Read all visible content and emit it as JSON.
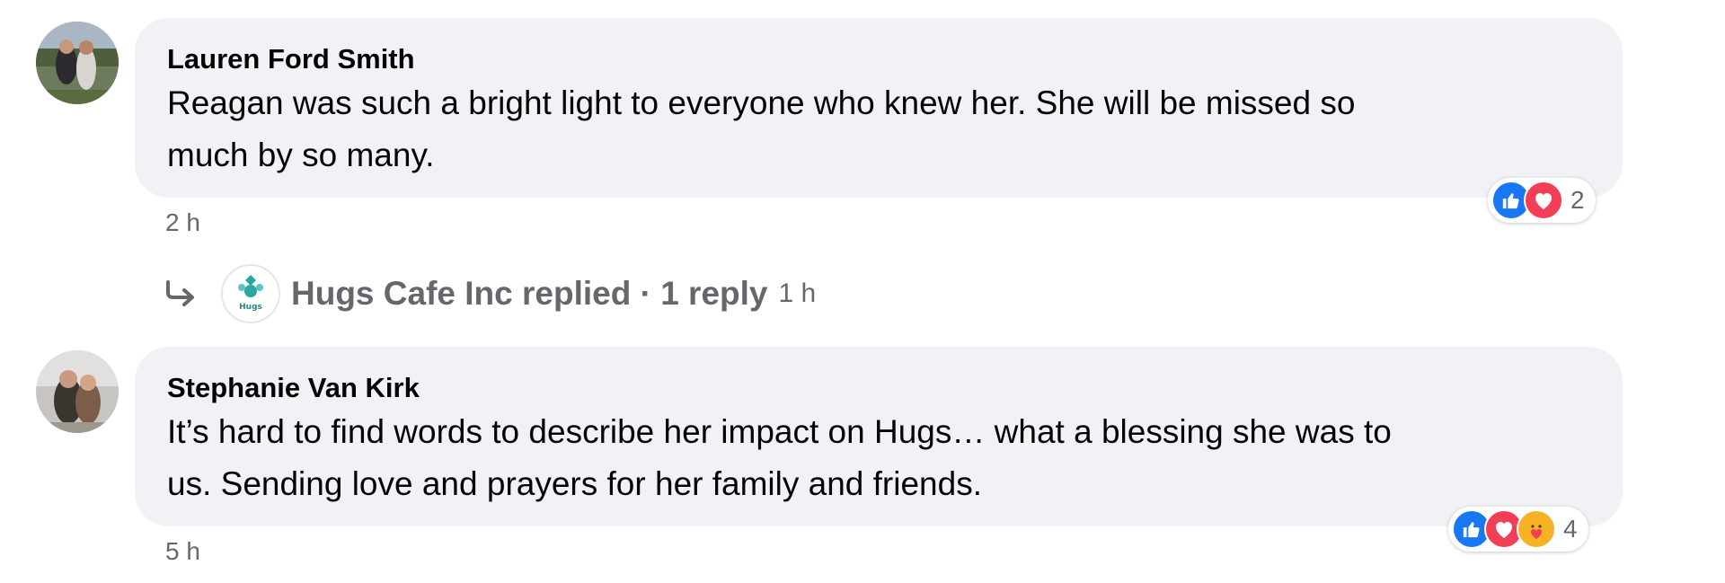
{
  "comments": [
    {
      "author": "Lauren Ford Smith",
      "text_line1": "Reagan was such a bright light to everyone who knew her. She will be missed so",
      "text_line2": "much by so many.",
      "time": "2 h",
      "reactions": [
        "like-icon",
        "love-icon"
      ],
      "reaction_count": "2"
    },
    {
      "author": "Stephanie Van Kirk",
      "text_line1": "It’s hard to find words to describe her impact on Hugs… what a blessing she was to",
      "text_line2": "us. Sending love and prayers for her family and friends.",
      "time": "5 h",
      "reactions": [
        "like-icon",
        "love-icon",
        "care-icon"
      ],
      "reaction_count": "4"
    }
  ],
  "reply_summary": {
    "page_name": "Hugs Cafe Inc",
    "label": "Hugs Cafe Inc replied · 1 reply",
    "time": "1 h",
    "page_logo_text": "Hugs"
  },
  "colors": {
    "bubble": "#f0f2f5",
    "secondary_text": "#65676b",
    "like": "#1877f2",
    "love": "#f33e58",
    "care": "#f7b125"
  }
}
